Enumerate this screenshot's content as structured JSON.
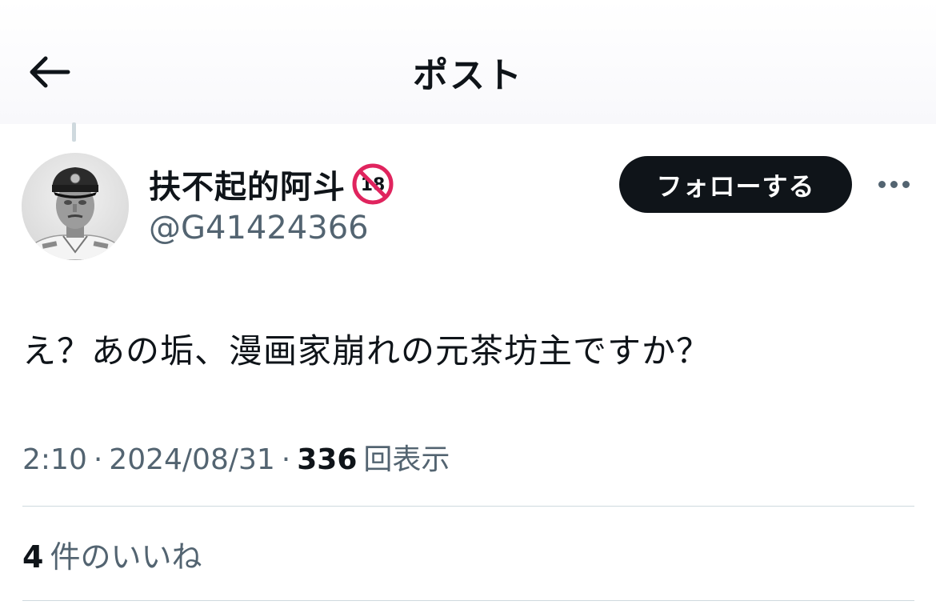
{
  "header": {
    "title": "ポスト",
    "back_icon": "arrow-left-icon"
  },
  "author": {
    "display_name": "扶不起的阿斗",
    "badge": "🔞",
    "badge_icon": "no-under-18-icon",
    "handle": "@G41424366",
    "follow_label": "フォローする",
    "more_icon": "more-horizontal-icon"
  },
  "post": {
    "text": "え？あの垢、漫画家崩れの元茶坊主ですか？",
    "time": "2:10",
    "separator": "·",
    "date": "2024/08/31",
    "views_count": "336",
    "views_label": "回表示"
  },
  "engagement": {
    "likes_count": "4",
    "likes_label": "件のいいね"
  },
  "colors": {
    "text_primary": "#0f1419",
    "text_secondary": "#536471",
    "divider": "#cfd9de",
    "button_bg": "#0f1419",
    "button_text": "#ffffff",
    "badge_red": "#e0245e"
  }
}
